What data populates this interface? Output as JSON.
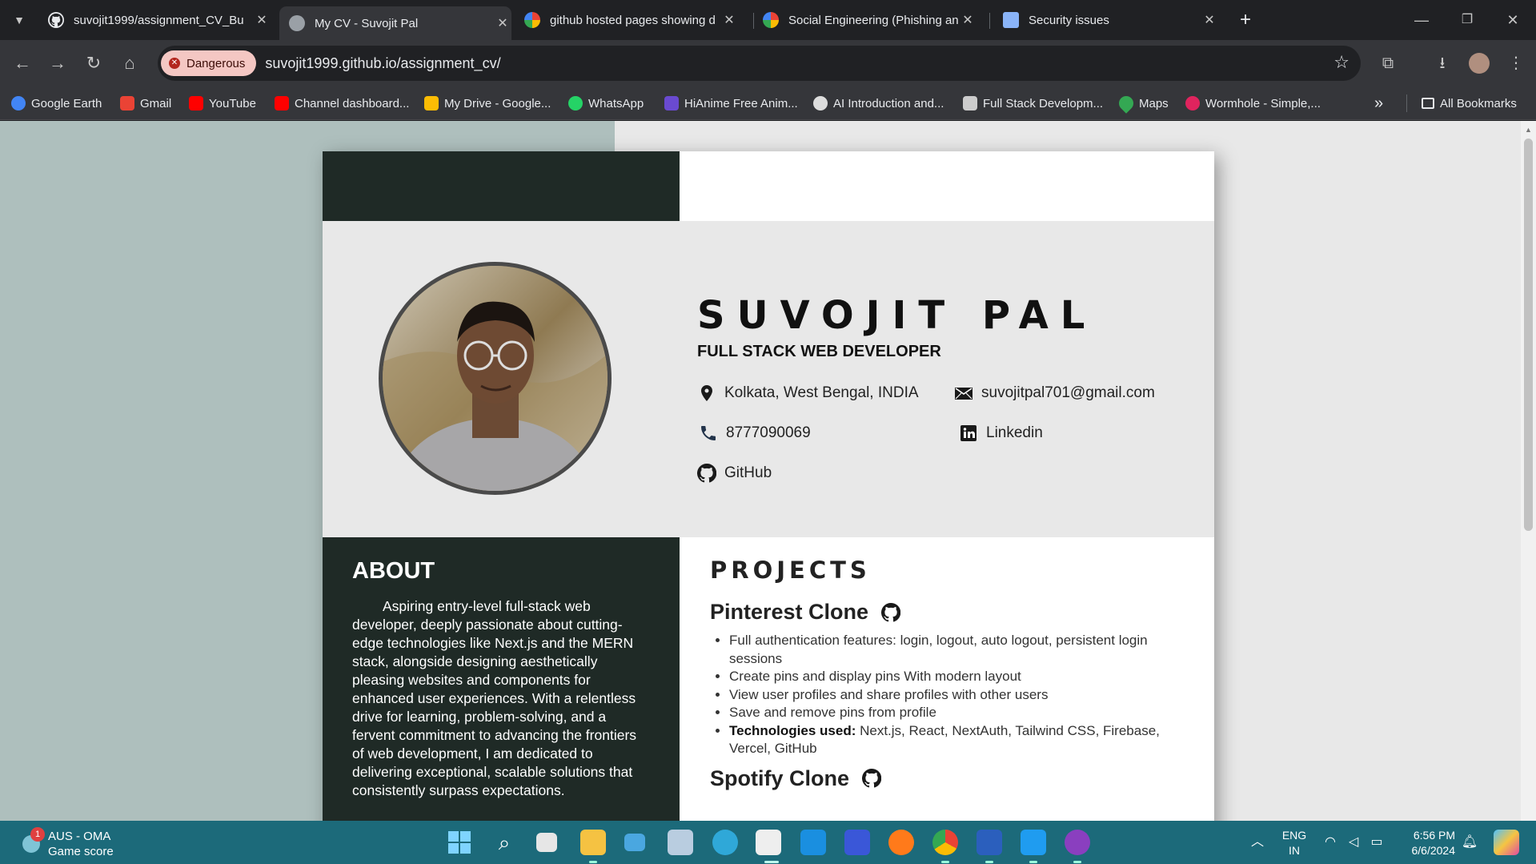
{
  "tabs": [
    {
      "title": "suvojit1999/assignment_CV_Bu",
      "icon": "github-icon",
      "active": false
    },
    {
      "title": "My CV - Suvojit Pal",
      "icon": "globe-icon",
      "active": true
    },
    {
      "title": "github hosted pages showing d",
      "icon": "google-icon",
      "active": false
    },
    {
      "title": "Social Engineering (Phishing an",
      "icon": "google-icon",
      "active": false
    },
    {
      "title": "Security issues",
      "icon": "tracker-icon",
      "active": false
    }
  ],
  "toolbar": {
    "security_chip": "Dangerous",
    "url": "suvojit1999.github.io/assignment_cv/"
  },
  "bookmarks": [
    {
      "label": "Google Earth",
      "color": "#4285f4"
    },
    {
      "label": "Gmail",
      "color": "#ea4335"
    },
    {
      "label": "YouTube",
      "color": "#ff0000"
    },
    {
      "label": "Channel dashboard...",
      "color": "#ff0000"
    },
    {
      "label": "My Drive - Google...",
      "color": "#fbbc04"
    },
    {
      "label": "WhatsApp",
      "color": "#25d366"
    },
    {
      "label": "HiAnime Free Anim...",
      "color": "#6a4ad1"
    },
    {
      "label": "AI Introduction and...",
      "color": "#dddddd"
    },
    {
      "label": "Full Stack Developm...",
      "color": "#cccccc"
    },
    {
      "label": "Maps",
      "color": "#34a853"
    },
    {
      "label": "Wormhole - Simple,...",
      "color": "#e0245e"
    }
  ],
  "bookmarks_overflow": "»",
  "all_bookmarks": "All Bookmarks",
  "cv": {
    "name": "SUVOJIT PAL",
    "role": "FULL STACK WEB DEVELOPER",
    "contacts": {
      "location": "Kolkata, West Bengal, INDIA",
      "email": "suvojitpal701@gmail.com",
      "phone": "8777090069",
      "linkedin": "Linkedin",
      "github": "GitHub"
    },
    "about_heading": "ABOUT",
    "about_text": "Aspiring entry-level full-stack web developer, deeply passionate about cutting-edge technologies like Next.js and the MERN stack, alongside designing aesthetically pleasing websites and components for enhanced user experiences. With a relentless drive for learning, problem-solving, and a fervent commitment to advancing the frontiers of web development, I am dedicated to delivering exceptional, scalable solutions that consistently surpass expectations.",
    "projects_heading": "PROJECTS",
    "projects": [
      {
        "title": "Pinterest Clone",
        "bullets": [
          "Full authentication features: login, logout, auto logout, persistent login sessions",
          "Create pins and display pins With modern layout",
          "View user profiles and share profiles with other users",
          "Save and remove pins from profile"
        ],
        "tech_label": "Technologies used:",
        "tech": " Next.js, React, NextAuth, Tailwind CSS, Firebase, Vercel, GitHub"
      },
      {
        "title": "Spotify Clone",
        "bullets": []
      }
    ]
  },
  "taskbar": {
    "weather_title": "AUS - OMA",
    "weather_sub": "Game score",
    "notification_count": "1",
    "lang_1": "ENG",
    "lang_2": "IN",
    "time": "6:56 PM",
    "date": "6/6/2024"
  }
}
